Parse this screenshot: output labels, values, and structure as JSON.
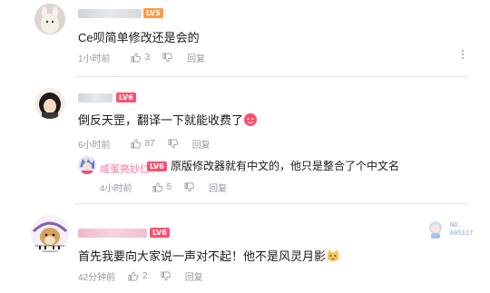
{
  "comments": [
    {
      "level": "LV5",
      "text": "Ce呗简单修改还是会的",
      "time": "1小时前",
      "likes": "3",
      "reply_label": "回复"
    },
    {
      "level": "LV6",
      "text": "倒反天罡，翻译一下就能收费了",
      "time": "6小时前",
      "likes": "87",
      "reply_label": "回复",
      "reply": {
        "name": "咸蛋亮妙仁",
        "level": "LV6",
        "text": "原版修改器就有中文的，他只是整合了个中文名",
        "time": "4小时前",
        "likes": "5",
        "reply_label": "回复"
      }
    },
    {
      "level": "LV6",
      "badge": "NO.\n005117",
      "text": "首先我要向大家说一声对不起！他不是风灵月影",
      "time": "42分钟前",
      "likes": "2",
      "reply_label": "回复"
    }
  ],
  "colors": {
    "accent_pink": "#fb7299",
    "level5": "#ff9a44",
    "level6": "#ff4f6e",
    "meta_gray": "#9499a0"
  }
}
